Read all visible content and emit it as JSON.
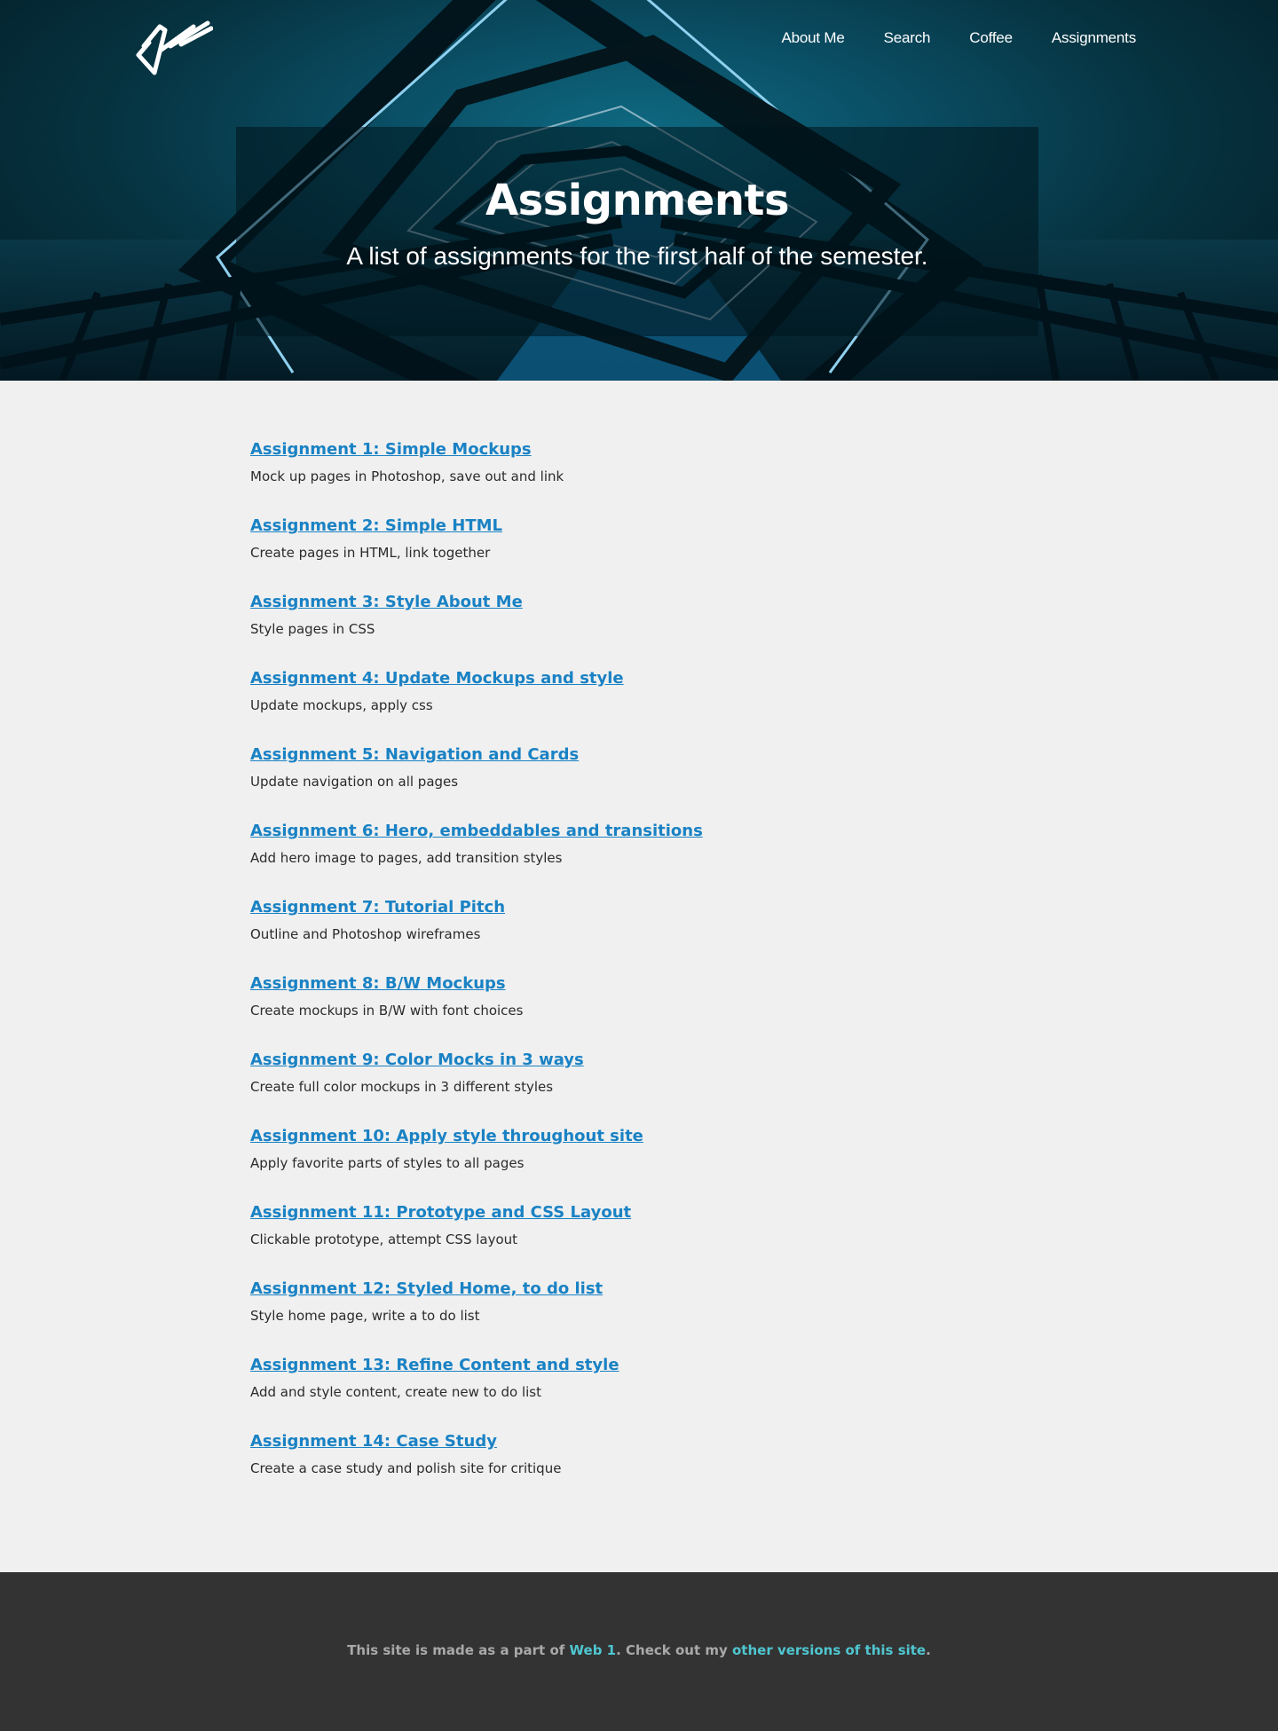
{
  "header": {
    "logo_icon": "signature-logo-icon",
    "nav": [
      {
        "label": "About Me"
      },
      {
        "label": "Search"
      },
      {
        "label": "Coffee"
      },
      {
        "label": "Assignments"
      }
    ]
  },
  "hero": {
    "title": "Assignments",
    "subtitle": "A list of assignments for the first half of the semester."
  },
  "assignments": [
    {
      "title": "Assignment 1: Simple Mockups",
      "desc": "Mock up pages in Photoshop, save out and link"
    },
    {
      "title": "Assignment 2: Simple HTML",
      "desc": "Create pages in HTML, link together"
    },
    {
      "title": "Assignment 3: Style About Me",
      "desc": "Style pages in CSS"
    },
    {
      "title": "Assignment 4: Update Mockups and style",
      "desc": "Update mockups, apply css"
    },
    {
      "title": "Assignment 5: Navigation and Cards",
      "desc": "Update navigation on all pages"
    },
    {
      "title": "Assignment 6: Hero, embeddables and transitions",
      "desc": "Add hero image to pages, add transition styles"
    },
    {
      "title": "Assignment 7: Tutorial Pitch",
      "desc": "Outline and Photoshop wireframes"
    },
    {
      "title": "Assignment 8: B/W Mockups",
      "desc": "Create mockups in B/W with font choices"
    },
    {
      "title": "Assignment 9: Color Mocks in 3 ways",
      "desc": "Create full color mockups in 3 different styles"
    },
    {
      "title": "Assignment 10: Apply style throughout site",
      "desc": "Apply favorite parts of styles to all pages"
    },
    {
      "title": "Assignment 11: Prototype and CSS Layout",
      "desc": "Clickable prototype, attempt CSS layout"
    },
    {
      "title": "Assignment 12: Styled Home, to do list",
      "desc": "Style home page, write a to do list"
    },
    {
      "title": "Assignment 13: Refine Content and style",
      "desc": "Add and style content, create new to do list"
    },
    {
      "title": "Assignment 14: Case Study",
      "desc": "Create a case study and polish site for critique"
    }
  ],
  "footer": {
    "text_1": "This site is made as a part of ",
    "link_1": "Web 1",
    "text_2": ". Check out my ",
    "link_2": "other versions of this site",
    "text_3": "."
  },
  "colors": {
    "link": "#1a82c4",
    "footer_link": "#4fc6d0",
    "footer_bg": "#333333",
    "page_bg": "#f0f0f0"
  }
}
